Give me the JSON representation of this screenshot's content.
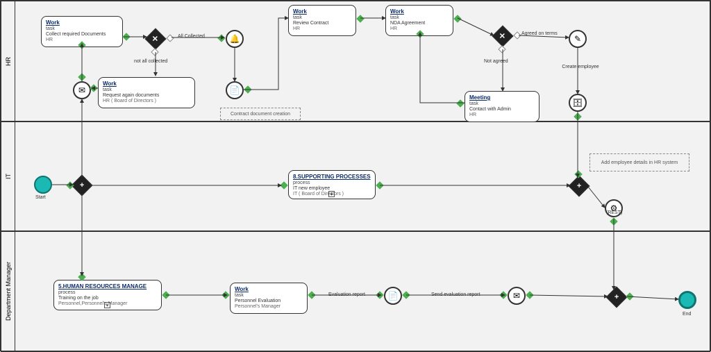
{
  "lanes": {
    "hr": "HR",
    "it": "IT",
    "dept": "Department Manager"
  },
  "start_label": "Start",
  "end_label": "End",
  "hr_tasks": {
    "collect": {
      "name": "Work",
      "type": "task",
      "desc": "Collect required Documents",
      "who": "HR"
    },
    "request": {
      "name": "Work",
      "type": "task",
      "desc": "Request again documents",
      "who": "HR ( Board of Directors )"
    },
    "review": {
      "name": "Work",
      "type": "task",
      "desc": "Review Contract",
      "who": "HR"
    },
    "nda": {
      "name": "Work",
      "type": "task",
      "desc": "NDA Agreement",
      "who": "HR"
    },
    "meeting": {
      "name": "Meeting",
      "type": "task",
      "desc": "Contact with Admin",
      "who": "HR"
    }
  },
  "it_tasks": {
    "supporting": {
      "name": "8.SUPPORTING PROCESSES",
      "type": "process",
      "desc": "IT new employee",
      "who": "IT ( Board of Directors )"
    }
  },
  "dept_tasks": {
    "hrm": {
      "name": "5.HUMAN RESOURCES MANAGE",
      "type": "process",
      "desc": "Training on the job",
      "who": "Personnel,Personnel's Manager"
    },
    "eval": {
      "name": "Work",
      "type": "task",
      "desc": "Personnel Evaluation",
      "who": "Personnel's Manager"
    }
  },
  "labels": {
    "all_collected": "All Collected",
    "not_all": "not all collected",
    "agreed": "Agreed on terms",
    "not_agreed": "Not agreed",
    "create_emp": "Create employee",
    "eval_report": "Evaluation report",
    "send_eval": "Send evaluation report",
    "rest": "(REST)"
  },
  "annotations": {
    "contract": "Contract document creation",
    "addemp": "Add employee details in HR system"
  },
  "icons": {
    "envelope": "✉",
    "bell": "🔔",
    "doc": "📄",
    "pen": "✎",
    "db": "🗄",
    "gear": "⚙",
    "send": "✉"
  },
  "chart_data": {
    "type": "diagram",
    "notation": "BPMN swimlane process",
    "lanes": [
      "HR",
      "IT",
      "Department Manager"
    ],
    "start_event": {
      "lane": "IT",
      "label": "Start"
    },
    "end_event": {
      "lane": "Department Manager",
      "label": "End"
    },
    "nodes": [
      {
        "id": "start",
        "type": "start-event",
        "lane": "IT"
      },
      {
        "id": "gw-par-1",
        "type": "parallel-gateway",
        "lane": "IT"
      },
      {
        "id": "msg-in",
        "type": "intermediate-message",
        "lane": "HR"
      },
      {
        "id": "collect",
        "type": "task",
        "lane": "HR",
        "label": "Work / Collect required Documents / HR"
      },
      {
        "id": "gw-excl-1",
        "type": "exclusive-gateway",
        "lane": "HR"
      },
      {
        "id": "request",
        "type": "task",
        "lane": "HR",
        "label": "Work / Request again documents / HR (Board of Directors)"
      },
      {
        "id": "bell",
        "type": "intermediate-signal",
        "lane": "HR"
      },
      {
        "id": "doc-create",
        "type": "intermediate-task",
        "lane": "HR",
        "annotation": "Contract document creation"
      },
      {
        "id": "review",
        "type": "task",
        "lane": "HR",
        "label": "Work / Review Contract / HR"
      },
      {
        "id": "nda",
        "type": "task",
        "lane": "HR",
        "label": "Work / NDA Agreement / HR"
      },
      {
        "id": "gw-excl-2",
        "type": "exclusive-gateway",
        "lane": "HR"
      },
      {
        "id": "meeting",
        "type": "task",
        "lane": "HR",
        "label": "Meeting / Contact with Admin / HR"
      },
      {
        "id": "create-emp",
        "type": "script-task",
        "lane": "HR",
        "label": "Create employee"
      },
      {
        "id": "db",
        "type": "data-store",
        "lane": "HR",
        "annotation": "Add employee details in HR system"
      },
      {
        "id": "supporting",
        "type": "subprocess",
        "lane": "IT",
        "label": "8.SUPPORTING PROCESSES / IT new employee / IT (Board of Directors)"
      },
      {
        "id": "gw-par-2",
        "type": "parallel-gateway",
        "lane": "IT"
      },
      {
        "id": "rest",
        "type": "service-task",
        "lane": "IT",
        "label": "(REST)"
      },
      {
        "id": "hrm",
        "type": "subprocess",
        "lane": "Department Manager",
        "label": "5.HUMAN RESOURCES MANAGE / Training on the job / Personnel,Personnel's Manager"
      },
      {
        "id": "eval",
        "type": "task",
        "lane": "Department Manager",
        "label": "Work / Personnel Evaluation / Personnel's Manager"
      },
      {
        "id": "doc-eval",
        "type": "intermediate-task",
        "lane": "Department Manager",
        "label": "Evaluation report"
      },
      {
        "id": "send-eval",
        "type": "intermediate-message-send",
        "lane": "Department Manager",
        "label": "Send evaluation report"
      },
      {
        "id": "gw-par-3",
        "type": "parallel-gateway",
        "lane": "Department Manager"
      },
      {
        "id": "end",
        "type": "end-event",
        "lane": "Department Manager"
      }
    ],
    "flows": [
      {
        "from": "start",
        "to": "gw-par-1"
      },
      {
        "from": "gw-par-1",
        "to": "msg-in"
      },
      {
        "from": "gw-par-1",
        "to": "supporting"
      },
      {
        "from": "gw-par-1",
        "to": "hrm"
      },
      {
        "from": "msg-in",
        "to": "collect"
      },
      {
        "from": "collect",
        "to": "gw-excl-1"
      },
      {
        "from": "gw-excl-1",
        "to": "bell",
        "label": "All Collected"
      },
      {
        "from": "gw-excl-1",
        "to": "request",
        "label": "not all collected"
      },
      {
        "from": "request",
        "to": "msg-in"
      },
      {
        "from": "bell",
        "to": "doc-create"
      },
      {
        "from": "doc-create",
        "to": "review"
      },
      {
        "from": "review",
        "to": "nda"
      },
      {
        "from": "nda",
        "to": "gw-excl-2"
      },
      {
        "from": "gw-excl-2",
        "to": "create-emp",
        "label": "Agreed on terms"
      },
      {
        "from": "gw-excl-2",
        "to": "meeting",
        "label": "Not agreed"
      },
      {
        "from": "meeting",
        "to": "nda"
      },
      {
        "from": "create-emp",
        "to": "db"
      },
      {
        "from": "db",
        "to": "gw-par-2"
      },
      {
        "from": "supporting",
        "to": "gw-par-2"
      },
      {
        "from": "gw-par-2",
        "to": "rest"
      },
      {
        "from": "rest",
        "to": "gw-par-3"
      },
      {
        "from": "hrm",
        "to": "eval"
      },
      {
        "from": "eval",
        "to": "doc-eval",
        "label": "Evaluation report"
      },
      {
        "from": "doc-eval",
        "to": "send-eval",
        "label": "Send evaluation report"
      },
      {
        "from": "send-eval",
        "to": "gw-par-3"
      },
      {
        "from": "gw-par-3",
        "to": "end"
      }
    ]
  }
}
